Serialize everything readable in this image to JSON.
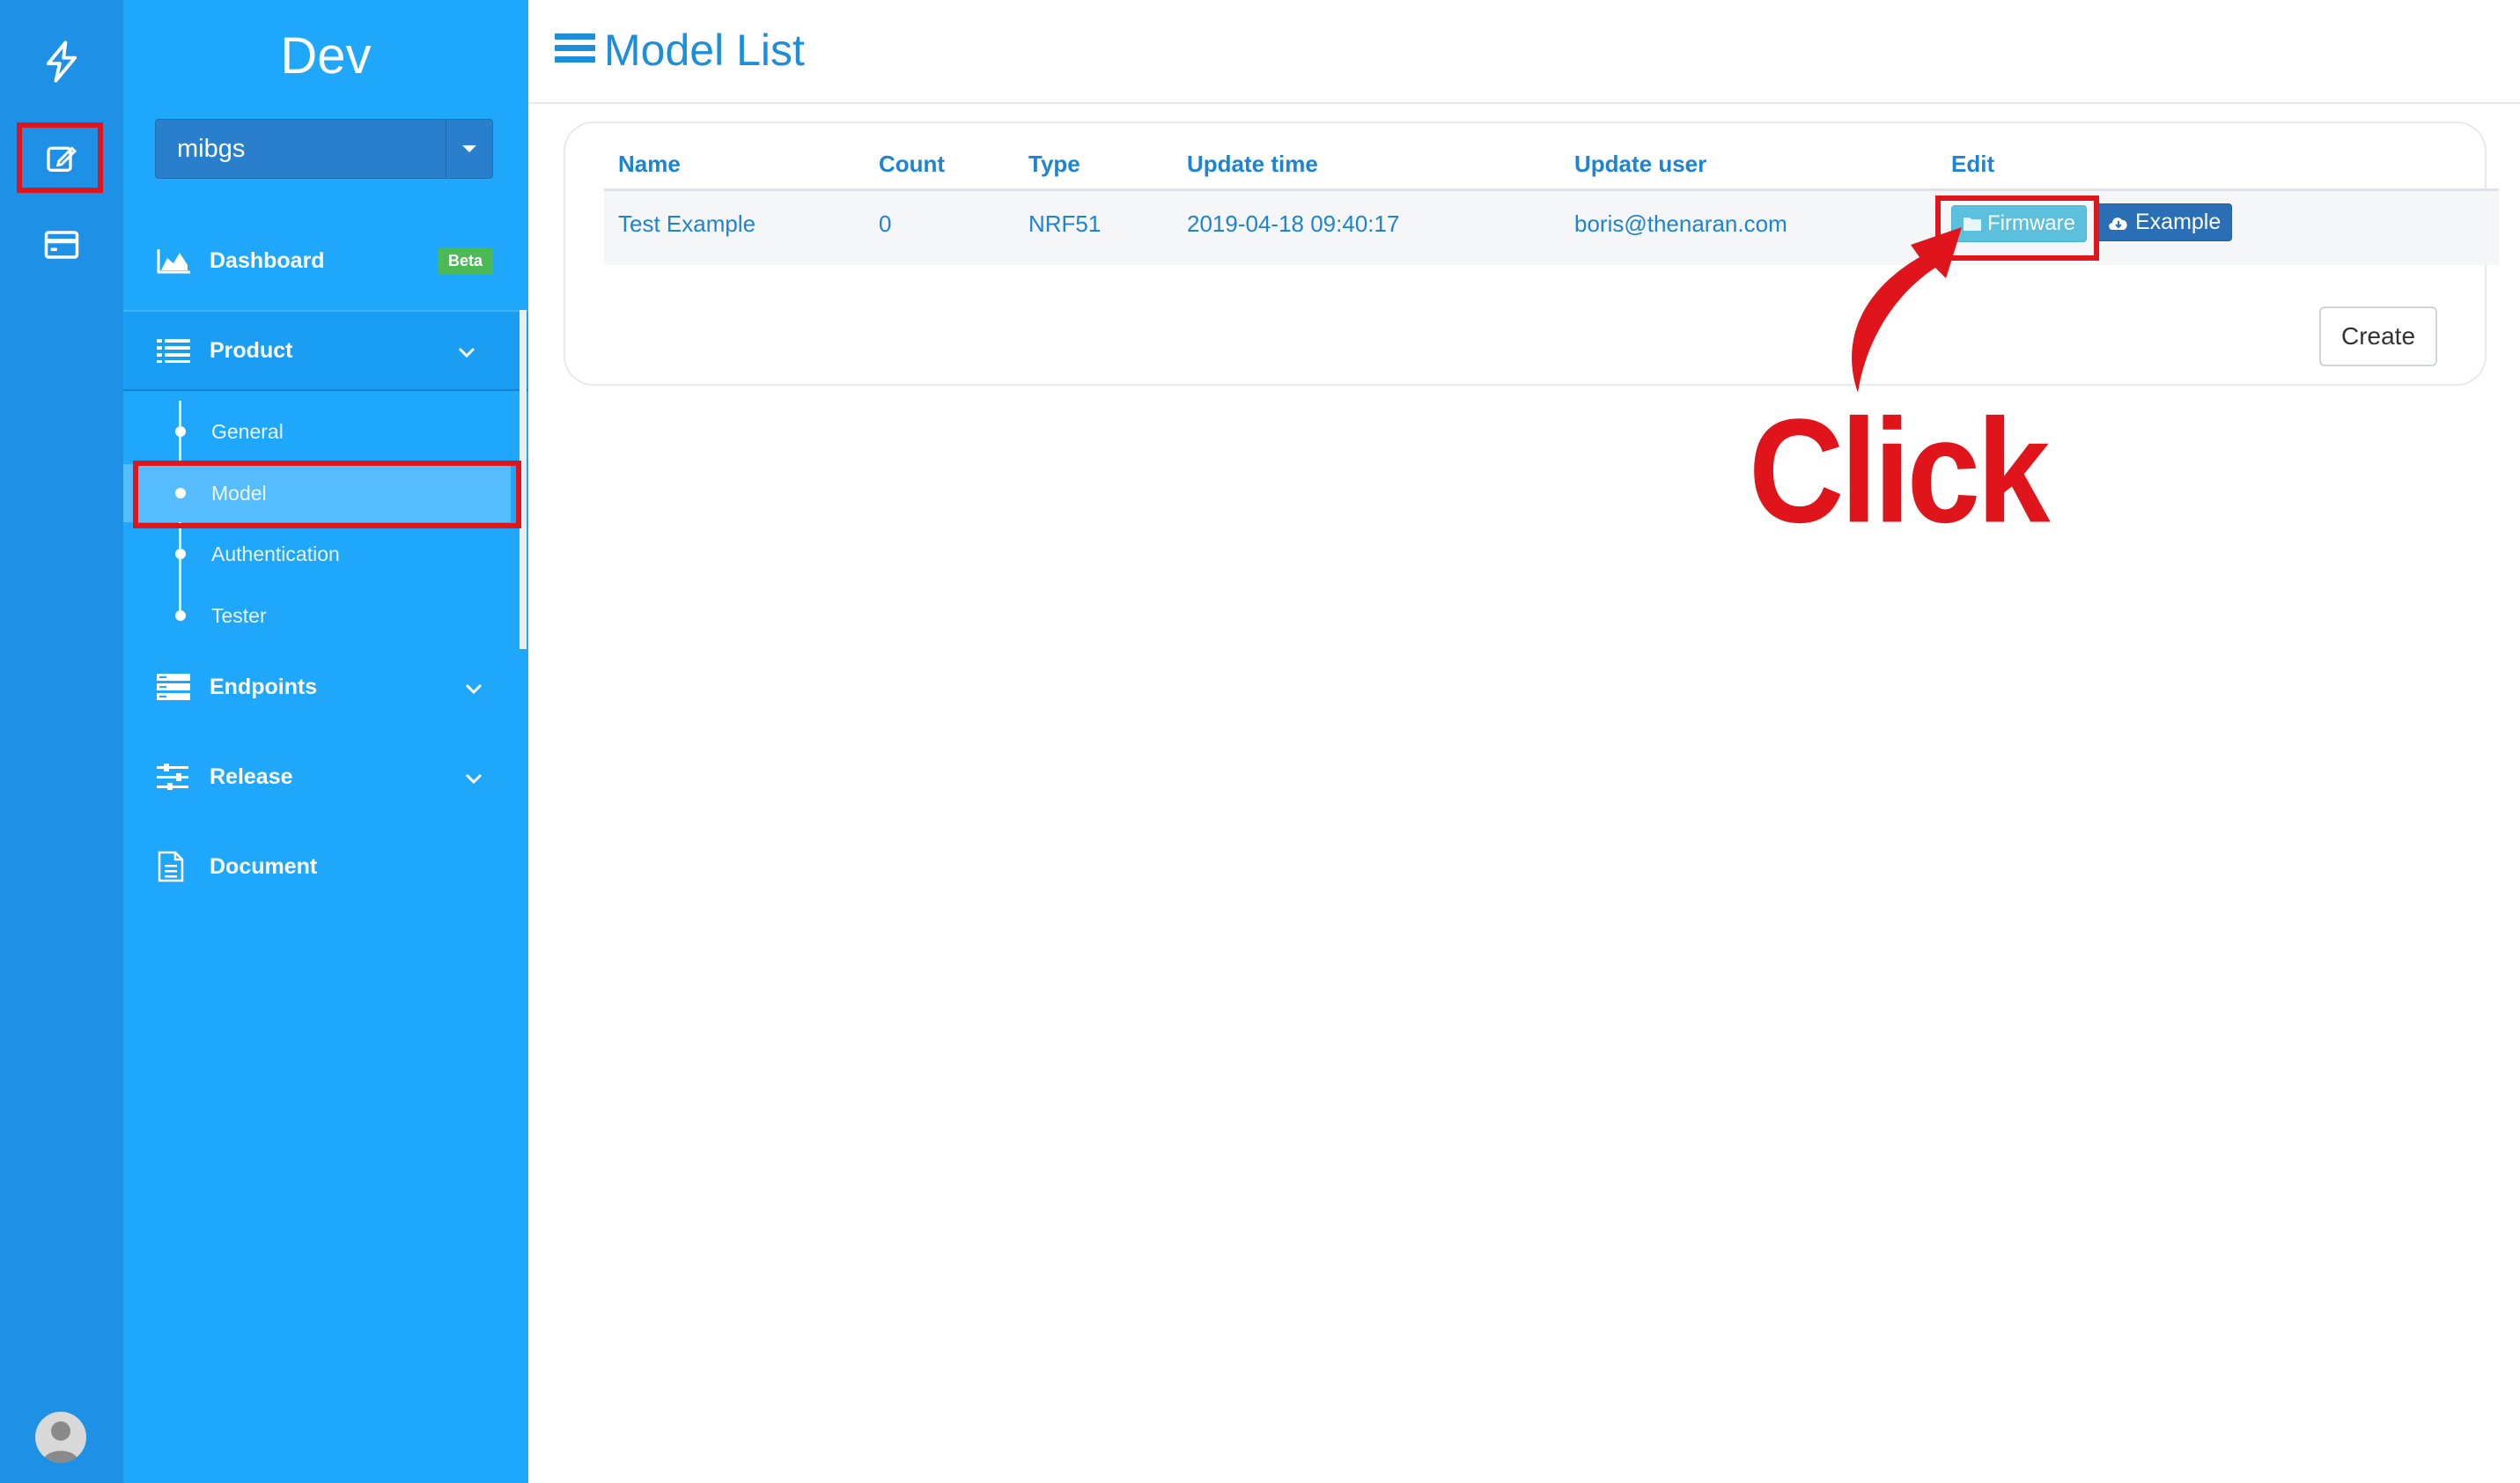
{
  "app": {
    "brand": "Dev"
  },
  "rail": {
    "icons": [
      "lightning-icon",
      "edit-icon",
      "card-icon"
    ],
    "avatar": "user-avatar"
  },
  "sidebar": {
    "project": {
      "value": "mibgs"
    },
    "items": [
      {
        "label": "Dashboard",
        "badge": "Beta",
        "icon": "chart-area-icon"
      },
      {
        "label": "Product",
        "icon": "list-icon",
        "expanded": true
      },
      {
        "label": "Endpoints",
        "icon": "server-icon"
      },
      {
        "label": "Release",
        "icon": "sliders-icon"
      },
      {
        "label": "Document",
        "icon": "document-icon"
      }
    ],
    "product_sub": [
      {
        "label": "General"
      },
      {
        "label": "Model",
        "active": true
      },
      {
        "label": "Authentication"
      },
      {
        "label": "Tester"
      }
    ]
  },
  "main": {
    "title": "Model List",
    "table": {
      "columns": [
        "Name",
        "Count",
        "Type",
        "Update time",
        "Update user",
        "Edit"
      ],
      "rows": [
        {
          "name": "Test Example",
          "count": "0",
          "type": "NRF51",
          "update_time": "2019-04-18 09:40:17",
          "update_user": "boris@thenaran.com",
          "edit": {
            "firmware": "Firmware",
            "example": "Example"
          }
        }
      ]
    },
    "create_label": "Create"
  },
  "annotation": {
    "text": "Click"
  },
  "colors": {
    "rail": "#1e90e6",
    "sidebar": "#1fa7fb",
    "accent": "#1e83d3",
    "highlight": "#e0141b",
    "firmware_button": "#5bc0de",
    "example_button": "#2a6fb5",
    "badge": "#4cba54"
  }
}
